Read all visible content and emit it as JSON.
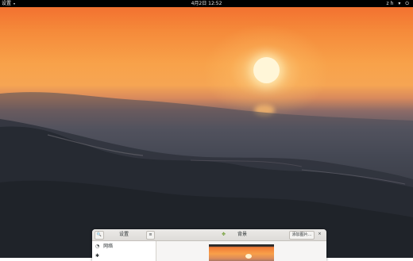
{
  "topbar": {
    "app_menu": "设置",
    "app_menu_arrow": "▾",
    "clock": "4月2日 12:52",
    "status_icons": "zh ▾ ⏻"
  },
  "settings": {
    "search_icon": "🔍",
    "sidebar_title": "设置",
    "menu_icon": "≡",
    "panel_icon": "✥",
    "panel_title": "背景",
    "add_button": "添加图片...",
    "close_icon": "×",
    "sidebar_items": [
      {
        "icon": "wifi-icon",
        "icon_glyph": "◔",
        "label": "网络"
      },
      {
        "icon": "bluetooth-icon",
        "icon_glyph": "✱",
        "label": ""
      }
    ]
  }
}
